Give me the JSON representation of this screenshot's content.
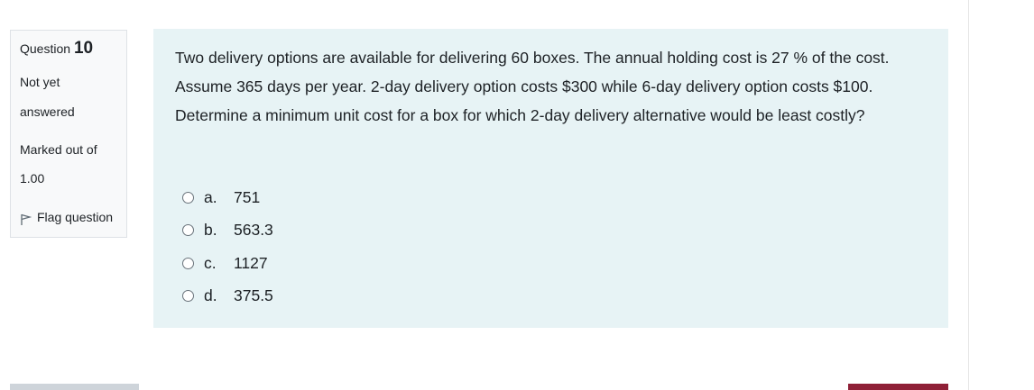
{
  "info": {
    "question_label": "Question",
    "question_number": "10",
    "status_line1": "Not yet",
    "status_line2": "answered",
    "marked_line1": "Marked out of",
    "marked_line2": "1.00",
    "flag_label": "Flag question"
  },
  "question": {
    "text": "Two delivery options are available for delivering 60 boxes. The annual holding cost is 27 % of the cost. Assume 365 days per year. 2-day delivery option costs $300 while 6-day delivery option costs $100. Determine a minimum unit cost for a box for which 2-day delivery alternative would be least costly?",
    "answers": [
      {
        "letter": "a.",
        "value": "751"
      },
      {
        "letter": "b.",
        "value": "563.3"
      },
      {
        "letter": "c.",
        "value": "1127"
      },
      {
        "letter": "d.",
        "value": "375.5"
      }
    ]
  },
  "icons": {
    "flag": "flag-icon",
    "radio": "radio-unselected-icon"
  },
  "colors": {
    "question_background": "#e7f3f5",
    "info_background": "#f8f9fa",
    "bottom_left_bar": "#ced4da",
    "bottom_right_bar": "#8f2037"
  }
}
